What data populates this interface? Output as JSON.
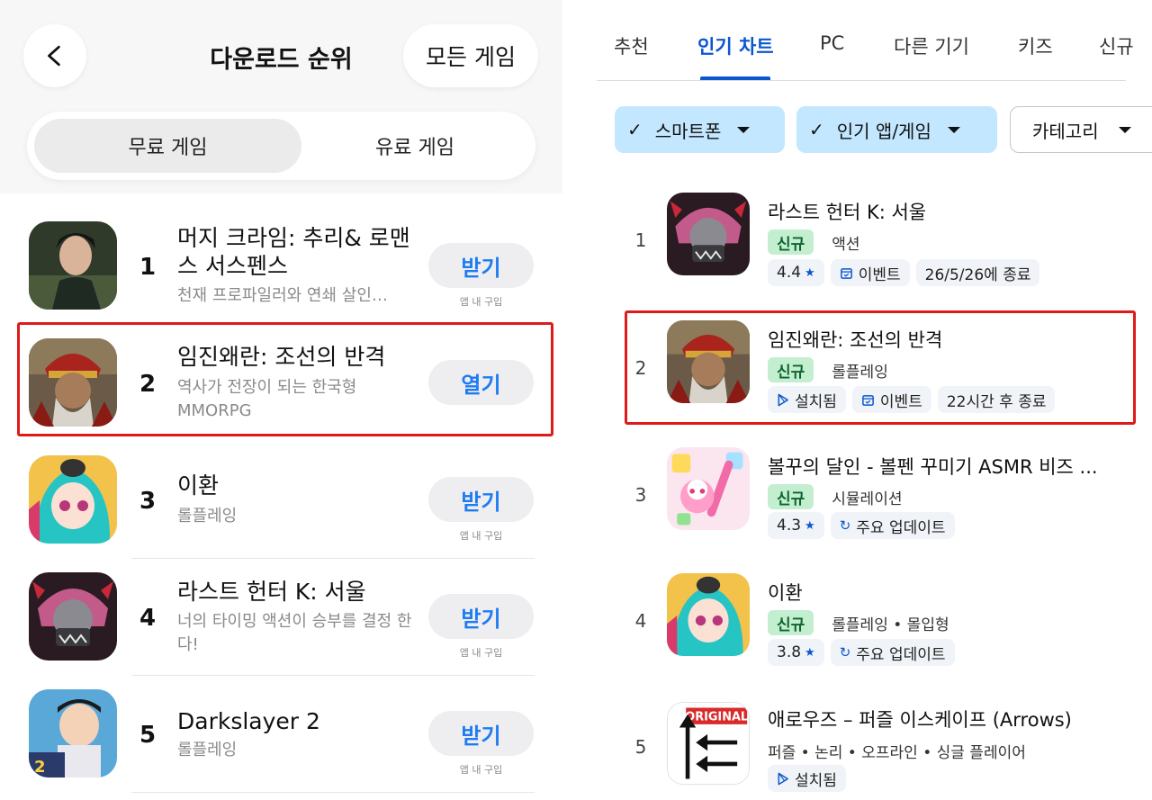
{
  "left": {
    "title": "다운로드 순위",
    "all_games_label": "모든 게임",
    "segments": {
      "free": "무료 게임",
      "paid": "유료 게임"
    },
    "iap_label": "앱 내 구입",
    "items": [
      {
        "rank": "1",
        "name": "머지 크라임: 추리& 로맨스 서스펜스",
        "sub": "천재 프로파일러와 연쇄 살인…",
        "button": "받기",
        "has_iap": true
      },
      {
        "rank": "2",
        "name": "임진왜란: 조선의 반격",
        "sub": "역사가 전장이 되는 한국형 MMORPG",
        "button": "열기",
        "has_iap": false
      },
      {
        "rank": "3",
        "name": "이환",
        "sub": "롤플레잉",
        "button": "받기",
        "has_iap": true
      },
      {
        "rank": "4",
        "name": "라스트 헌터 K: 서울",
        "sub": "너의 타이밍 액션이 승부를 결정 한다!",
        "button": "받기",
        "has_iap": true
      },
      {
        "rank": "5",
        "name": "Darkslayer 2",
        "sub": "롤플레잉",
        "button": "받기",
        "has_iap": true
      }
    ]
  },
  "right": {
    "tabs": [
      "추천",
      "인기 차트",
      "PC",
      "다른 기기",
      "키즈",
      "신규"
    ],
    "active_tab": "인기 차트",
    "chips": [
      "스마트폰",
      "인기 앱/게임",
      "카테고리"
    ],
    "new_label": "신규",
    "items": [
      {
        "rank": "1",
        "name": "라스트 헌터 K: 서울",
        "is_new": true,
        "category": "액션",
        "rating": "4.4",
        "tag1": "이벤트",
        "tag2": "26/5/26에 종료"
      },
      {
        "rank": "2",
        "name": "임진왜란: 조선의 반격",
        "is_new": true,
        "category": "롤플레잉",
        "installed": "설치됨",
        "tag1": "이벤트",
        "tag2": "22시간 후 종료"
      },
      {
        "rank": "3",
        "name": "볼꾸의 달인 - 볼펜 꾸미기 ASMR 비즈 ...",
        "is_new": true,
        "category": "시뮬레이션",
        "rating": "4.3",
        "tag1": "주요 업데이트"
      },
      {
        "rank": "4",
        "name": "이환",
        "is_new": true,
        "category": "롤플레잉 • 몰입형",
        "rating": "3.8",
        "tag1": "주요 업데이트"
      },
      {
        "rank": "5",
        "name": "애로우즈 – 퍼즐 이스케이프 (Arrows)",
        "meta": "퍼즐 • 논리 • 오프라인 • 싱글 플레이어",
        "installed": "설치됨",
        "icon_text": "ORIGINAL"
      }
    ]
  },
  "colors": {
    "highlight_box": "#e01a1a",
    "ios_blue": "#1e7bf2",
    "play_blue": "#0b57d0",
    "new_badge_bg": "#c4eed0",
    "chip_selected": "#c2e7ff"
  }
}
